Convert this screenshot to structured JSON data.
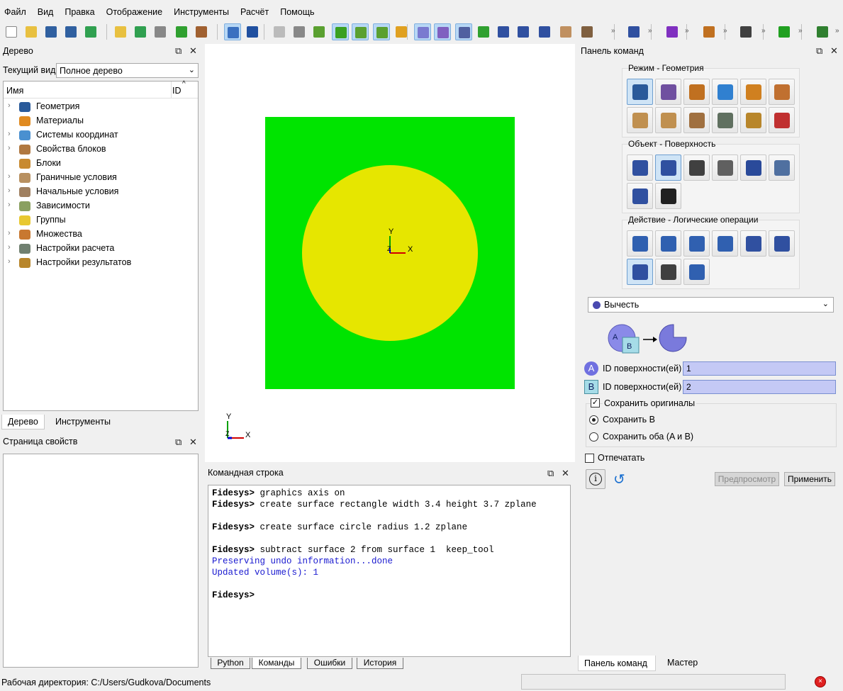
{
  "menu": [
    "Файл",
    "Вид",
    "Правка",
    "Отображение",
    "Инструменты",
    "Расчёт",
    "Помощь"
  ],
  "tree_panel": {
    "title": "Дерево",
    "current_view_label": "Текущий вид",
    "current_view_value": "Полное дерево",
    "col_name": "Имя",
    "col_id": "ID",
    "items": [
      {
        "label": "Геометрия",
        "icon": "geometry-icon",
        "color": "#2a5a9a",
        "expand": true
      },
      {
        "label": "Материалы",
        "icon": "materials-icon",
        "color": "#e08a20",
        "expand": false
      },
      {
        "label": "Системы координат",
        "icon": "coord-systems-icon",
        "color": "#4a90d0",
        "expand": true
      },
      {
        "label": "Свойства блоков",
        "icon": "block-properties-icon",
        "color": "#b07840",
        "expand": true
      },
      {
        "label": "Блоки",
        "icon": "blocks-icon",
        "color": "#c88a30",
        "expand": false
      },
      {
        "label": "Граничные условия",
        "icon": "boundary-conditions-icon",
        "color": "#b89060",
        "expand": true
      },
      {
        "label": "Начальные условия",
        "icon": "initial-conditions-icon",
        "color": "#a08060",
        "expand": true
      },
      {
        "label": "Зависимости",
        "icon": "dependencies-icon",
        "color": "#8aa060",
        "expand": true
      },
      {
        "label": "Группы",
        "icon": "groups-icon",
        "color": "#e8c830",
        "expand": false
      },
      {
        "label": "Множества",
        "icon": "sets-icon",
        "color": "#c87830",
        "expand": true
      },
      {
        "label": "Настройки расчета",
        "icon": "calc-settings-icon",
        "color": "#708070",
        "expand": true
      },
      {
        "label": "Настройки результатов",
        "icon": "results-settings-icon",
        "color": "#b8862b",
        "expand": true
      }
    ],
    "tabs": [
      "Дерево",
      "Инструменты"
    ]
  },
  "properties_panel": {
    "title": "Страница свойств"
  },
  "viewport": {
    "rect_color": "#00e400",
    "circle_color": "#e6e600",
    "axis_x": "X",
    "axis_y": "Y",
    "axis_z": "Z"
  },
  "command_panel_bottom": {
    "title": "Командная строка",
    "lines": [
      {
        "prompt": "Fidesys>",
        "text": " graphics axis on"
      },
      {
        "prompt": "Fidesys>",
        "text": " create surface rectangle width 3.4 height 3.7 zplane"
      },
      {
        "prompt": "",
        "text": ""
      },
      {
        "prompt": "Fidesys>",
        "text": " create surface circle radius 1.2 zplane"
      },
      {
        "prompt": "",
        "text": ""
      },
      {
        "prompt": "Fidesys>",
        "text": " subtract surface 2 from surface 1  keep_tool"
      },
      {
        "prompt": "",
        "text": "Preserving undo information...done",
        "blue": true
      },
      {
        "prompt": "",
        "text": "Updated volume(s): 1",
        "blue": true
      },
      {
        "prompt": "",
        "text": ""
      },
      {
        "prompt": "Fidesys>",
        "text": ""
      }
    ],
    "tabs": [
      "Python",
      "Команды",
      "Ошибки",
      "История"
    ]
  },
  "right_panel": {
    "title": "Панель команд",
    "mode_title": "Режим - Геометрия",
    "object_title": "Объект - Поверхность",
    "action_title": "Действие - Логические операции",
    "operation": "Вычесть",
    "label_a": "A",
    "label_b": "B",
    "id_label": "ID поверхности(ей)",
    "id_a": "1",
    "id_b": "2",
    "keep_originals": "Сохранить оригиналы",
    "keep_b": "Сохранить B",
    "keep_both": "Сохранить оба (A и B)",
    "imprint": "Отпечатать",
    "preview": "Предпросмотр",
    "apply": "Применить",
    "tabs": [
      "Панель команд",
      "Мастер"
    ]
  },
  "status": {
    "workdir": "Рабочая директория: C:/Users/Gudkova/Documents"
  }
}
